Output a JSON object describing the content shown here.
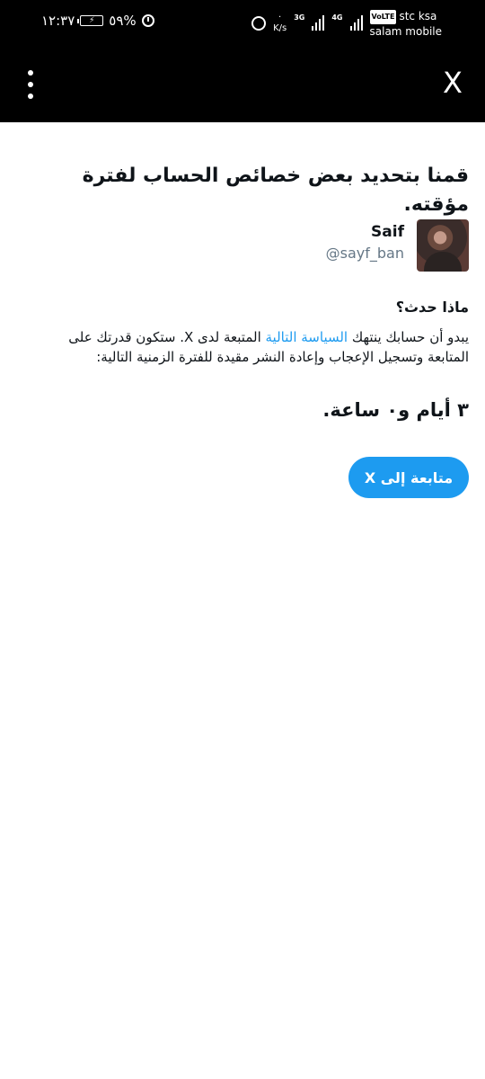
{
  "status_bar": {
    "time": "١٢:٣٧",
    "battery_percent": "٥٩%",
    "speed_unit": "K/s",
    "net_label_1": "3G",
    "net_label_2": "4G",
    "volte": "VoLTE",
    "carrier_1": "stc ksa",
    "carrier_2": "salam mobile",
    "icons": [
      "alarm-icon",
      "battery-icon",
      "sync-icon",
      "signal-icon"
    ]
  },
  "app_bar": {
    "close_label": "X",
    "menu_icon": "more-vertical-icon"
  },
  "main": {
    "title": "قمنا بتحديد بعض خصائص الحساب لفترة مؤقته.",
    "user": {
      "name": "Saif",
      "handle": "@sayf_ban"
    },
    "section_heading": "ماذا حدث؟",
    "description_before": "يبدو أن حسابك ينتهك ",
    "policy_link": "السياسة التالية",
    "description_after": " المتبعة لدى X. ستكون قدرتك على المتابعة وتسجيل الإعجاب وإعادة النشر مقيدة للفترة الزمنية التالية:",
    "duration": "٣ أيام و٠ ساعة.",
    "continue_button": "متابعة إلى X"
  },
  "colors": {
    "accent": "#1d9bf0",
    "text": "#0f1419",
    "muted": "#657786",
    "bar": "#000000"
  }
}
